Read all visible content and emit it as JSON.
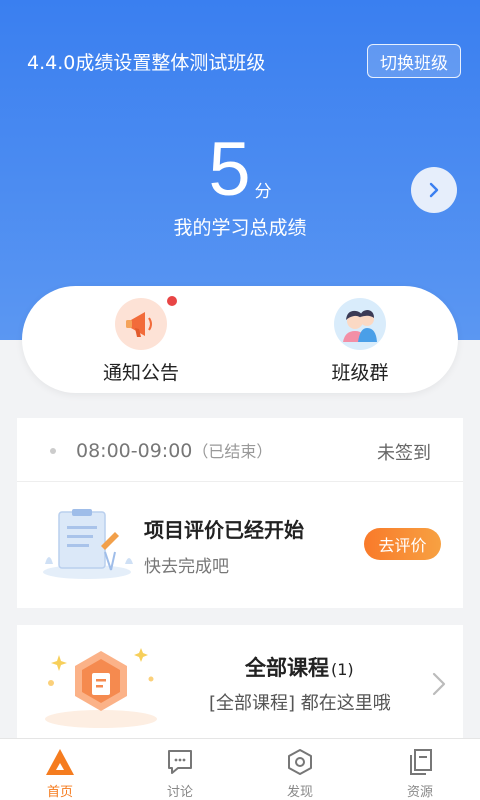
{
  "header": {
    "class_title": "4.4.0成绩设置整体测试班级",
    "switch_label": "切换班级",
    "score_value": "5",
    "score_unit": "分",
    "score_label": "我的学习总成绩"
  },
  "quick": {
    "notice_label": "通知公告",
    "group_label": "班级群"
  },
  "checkin": {
    "time": "08:00-09:00",
    "ended": "（已结束）",
    "status": "未签到"
  },
  "evaluation": {
    "title": "项目评价已经开始",
    "subtitle": "快去完成吧",
    "button": "去评价"
  },
  "courses": {
    "title": "全部课程",
    "count": "(1)",
    "subtitle": "[全部课程] 都在这里哦"
  },
  "tabs": [
    {
      "label": "首页",
      "icon": "home-icon",
      "active": true
    },
    {
      "label": "讨论",
      "icon": "discussion-icon",
      "active": false
    },
    {
      "label": "发现",
      "icon": "discover-icon",
      "active": false
    },
    {
      "label": "资源",
      "icon": "resources-icon",
      "active": false
    }
  ],
  "colors": {
    "brand_blue": "#3a7ff0",
    "accent_orange": "#f57c1f"
  }
}
